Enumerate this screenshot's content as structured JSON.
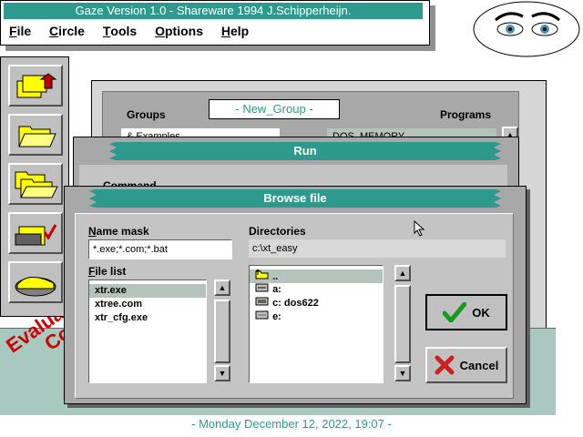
{
  "app": {
    "title": "Gaze Version 1.0 - Shareware 1994 J.Schipperheijn.",
    "menu": [
      {
        "label": "File",
        "hot": "F",
        "rest": "ile"
      },
      {
        "label": "Circle",
        "hot": "C",
        "rest": "ircle"
      },
      {
        "label": "Tools",
        "hot": "T",
        "rest": "ools"
      },
      {
        "label": "Options",
        "hot": "O",
        "rest": "ptions"
      },
      {
        "label": "Help",
        "hot": "H",
        "rest": "elp"
      }
    ]
  },
  "sidebar": {
    "icons": [
      "folder-upload-icon",
      "folder-open-icon",
      "folders-icon",
      "folder-check-icon",
      "disk-icon"
    ]
  },
  "background_window": {
    "groups_label": "Groups",
    "group_name": "- New_Group -",
    "programs_label": "Programs",
    "group_field": "& Examples",
    "program_field": "DOS_MEMORY"
  },
  "run_dialog": {
    "title": "Run",
    "partial_label": "Command"
  },
  "browse_dialog": {
    "title": "Browse file",
    "name_mask_label": "Name mask",
    "name_mask_value": "*.exe;*.com;*.bat",
    "directories_label": "Directories",
    "directory_value": "c:\\xt_easy",
    "file_list_label": "File list",
    "files": [
      "xtr.exe",
      "xtree.com",
      "xtr_cfg.exe"
    ],
    "dirs": [
      {
        "label": "..",
        "icon": "parent-folder-icon"
      },
      {
        "label": "a:",
        "icon": "floppy-drive-icon"
      },
      {
        "label": "c:  dos622",
        "icon": "hard-drive-icon"
      },
      {
        "label": "e:",
        "icon": "cdrom-drive-icon"
      }
    ],
    "ok_label": "OK",
    "cancel_label": "Cancel"
  },
  "status": {
    "date": "- Monday December 12, 2022, 19:07 -",
    "eval_text": "Evaluati Co"
  },
  "colors": {
    "teal": "#2e9a8e",
    "face": "#c4c4c4"
  }
}
